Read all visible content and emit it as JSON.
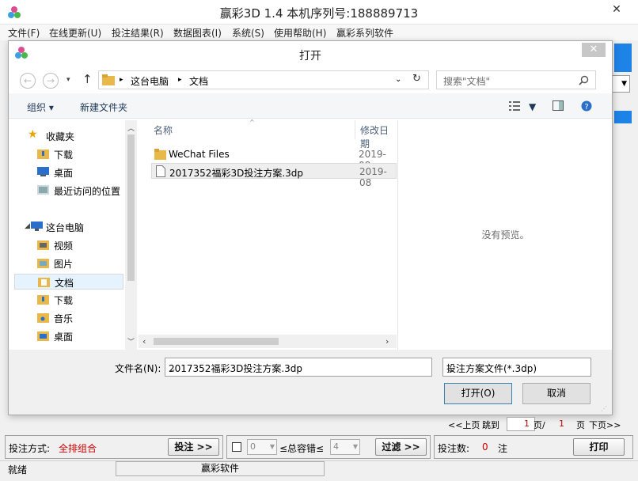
{
  "window": {
    "title": "赢彩3D 1.4  本机序列号:188889713",
    "close": "✕"
  },
  "menu": [
    "文件(F)",
    "在线更新(U)",
    "投注结果(R)",
    "数据图表(I)",
    "系统(S)",
    "使用帮助(H)",
    "赢彩系列软件"
  ],
  "dialog": {
    "title": "打开",
    "close": "✕",
    "address": {
      "root": "这台电脑",
      "current": "文档"
    },
    "search_placeholder": "搜索\"文档\"",
    "toolbar": {
      "organize": "组织 ▾",
      "new_folder": "新建文件夹"
    },
    "nav": {
      "favorites": "收藏夹",
      "fav_items": [
        "下载",
        "桌面",
        "最近访问的位置"
      ],
      "this_pc": "这台电脑",
      "pc_items": [
        "视频",
        "图片",
        "文档",
        "下载",
        "音乐",
        "桌面"
      ]
    },
    "columns": {
      "name": "名称",
      "modified": "修改日期"
    },
    "files": [
      {
        "name": "WeChat Files",
        "date": "2019-08",
        "kind": "folder"
      },
      {
        "name": "2017352福彩3D投注方案.3dp",
        "date": "2019-08",
        "kind": "file"
      }
    ],
    "preview_text": "没有预览。",
    "filename_label": "文件名(N):",
    "filename_value": "2017352福彩3D投注方案.3dp",
    "filetype_value": "投注方案文件(*.3dp)",
    "open_button": "打开(O)",
    "cancel_button": "取消"
  },
  "pager": {
    "prev": "<<上页",
    "goto": "跳到",
    "page_value": "1",
    "page_sep": "页/",
    "total_pages": "1",
    "page_unit": "页",
    "next": "下页>>"
  },
  "bottom": {
    "bet_mode_label": "投注方式:",
    "bet_mode_value": "全排组合",
    "bet_button": "投注 >>",
    "spin_left": "0",
    "tolerance_label": "≤总容错≤",
    "spin_right": "4",
    "filter_button": "过滤 >>",
    "bet_count_label": "投注数:",
    "bet_count_value": "0",
    "bet_count_unit": "注",
    "print_button": "打印"
  },
  "status": {
    "left": "就绪",
    "center": "赢彩软件"
  },
  "colors": {
    "accent_red": "#cc0000",
    "blue_panel": "#1e83e6",
    "folder": "#e8b84a"
  }
}
